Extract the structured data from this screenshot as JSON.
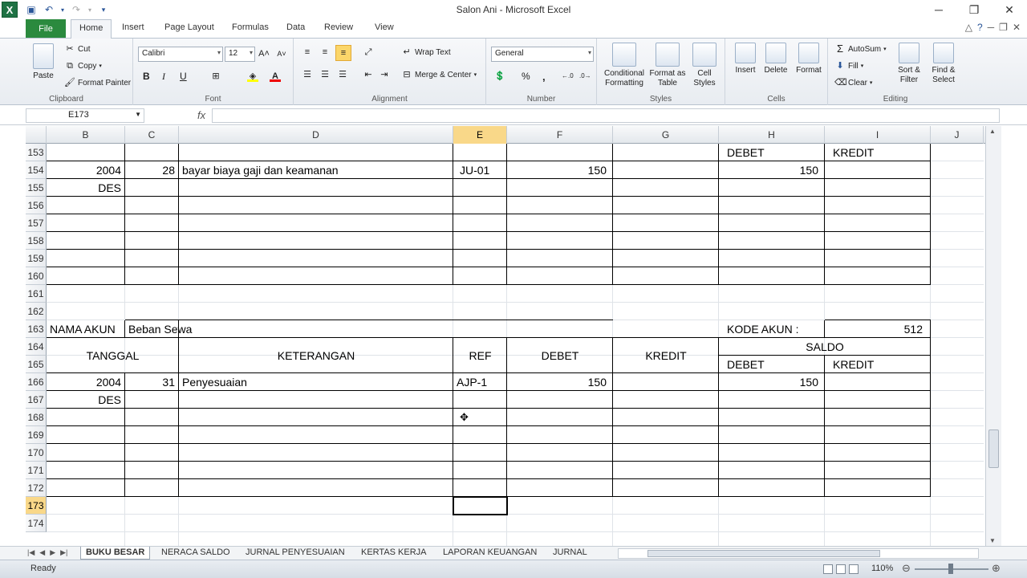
{
  "app": {
    "title": "Salon Ani - Microsoft Excel",
    "logo": "X"
  },
  "qat": {
    "save": "save-icon",
    "undo": "undo-icon",
    "redo": "redo-icon",
    "customize": "customize-icon"
  },
  "window": {
    "minimize": "─",
    "restore": "❐",
    "close": "✕"
  },
  "ribbon_tabs": {
    "file": "File",
    "home": "Home",
    "insert": "Insert",
    "page_layout": "Page Layout",
    "formulas": "Formulas",
    "data": "Data",
    "review": "Review",
    "view": "View"
  },
  "ribbon": {
    "clipboard": {
      "label": "Clipboard",
      "paste": "Paste",
      "cut": "Cut",
      "copy": "Copy",
      "format_painter": "Format Painter"
    },
    "font": {
      "label": "Font",
      "name": "Calibri",
      "size": "12",
      "bold": "B",
      "italic": "I",
      "underline": "U"
    },
    "alignment": {
      "label": "Alignment",
      "wrap": "Wrap Text",
      "merge": "Merge & Center"
    },
    "number": {
      "label": "Number",
      "format": "General",
      "percent": "%",
      "comma": ","
    },
    "styles": {
      "label": "Styles",
      "conditional": "Conditional Formatting",
      "format_table": "Format as Table",
      "cell_styles": "Cell Styles"
    },
    "cells": {
      "label": "Cells",
      "insert": "Insert",
      "delete": "Delete",
      "format": "Format"
    },
    "editing": {
      "label": "Editing",
      "autosum": "AutoSum",
      "fill": "Fill",
      "clear": "Clear",
      "sort": "Sort & Filter",
      "find": "Find & Select"
    }
  },
  "formula_bar": {
    "name_box": "E173",
    "fx": "fx",
    "value": ""
  },
  "columns": [
    "B",
    "C",
    "D",
    "E",
    "F",
    "G",
    "H",
    "I",
    "J"
  ],
  "rows": [
    "153",
    "154",
    "155",
    "156",
    "157",
    "158",
    "159",
    "160",
    "161",
    "162",
    "163",
    "164",
    "165",
    "166",
    "167",
    "168",
    "169",
    "170",
    "171",
    "172",
    "173",
    "174"
  ],
  "cells": {
    "h153": "DEBET",
    "i153": "KREDIT",
    "b154": "2004",
    "c154": "28",
    "d154": "bayar biaya gaji dan keamanan",
    "e154": "JU-01",
    "f154": "150",
    "h154": "150",
    "b155": "DES",
    "b163": "NAMA AKUN",
    "c163": "Beban Sewa",
    "h163": "KODE AKUN  :",
    "i163": "512",
    "tanggal": "TANGGAL",
    "keterangan": "KETERANGAN",
    "ref": "REF",
    "debet": "DEBET",
    "kredit": "KREDIT",
    "saldo": "SALDO",
    "h165": "DEBET",
    "i165": "KREDIT",
    "b166": "2004",
    "c166": "31",
    "d166": "Penyesuaian",
    "e166": "AJP-1",
    "f166": "150",
    "h166": "150",
    "b167": "DES"
  },
  "sheets": [
    "BUKU BESAR",
    "NERACA SALDO",
    "JURNAL PENYESUAIAN",
    "KERTAS KERJA",
    "LAPORAN KEUANGAN",
    "JURNAL PEN"
  ],
  "status": {
    "ready": "Ready",
    "zoom": "110%"
  }
}
